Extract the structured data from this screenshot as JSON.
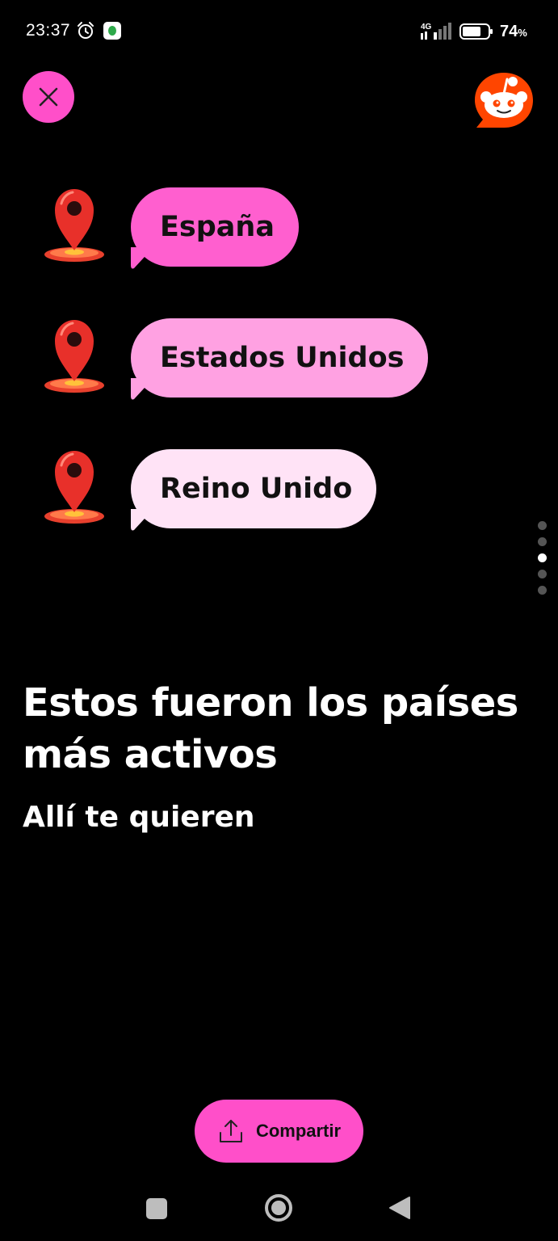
{
  "status_bar": {
    "time": "23:37",
    "network": "4G",
    "battery_percent": "74",
    "battery_unit": "%"
  },
  "header": {
    "close_icon": "close-icon",
    "logo_icon": "reddit-snoo-logo"
  },
  "countries": [
    {
      "label": "España",
      "color": "#ff5fcf"
    },
    {
      "label": "Estados Unidos",
      "color": "#ffa1e2"
    },
    {
      "label": "Reino Unido",
      "color": "#ffe3f6"
    }
  ],
  "pager": {
    "count": 5,
    "active_index": 2
  },
  "headline": "Estos fueron los países más activos",
  "subheadline": "Allí te quieren",
  "share": {
    "label": "Compartir",
    "icon": "share-icon"
  },
  "colors": {
    "accent": "#ff4fc9",
    "background": "#000000",
    "reddit_orange": "#ff4500"
  },
  "nav_bar": {
    "recents_icon": "square-icon",
    "home_icon": "circle-icon",
    "back_icon": "triangle-back-icon"
  }
}
